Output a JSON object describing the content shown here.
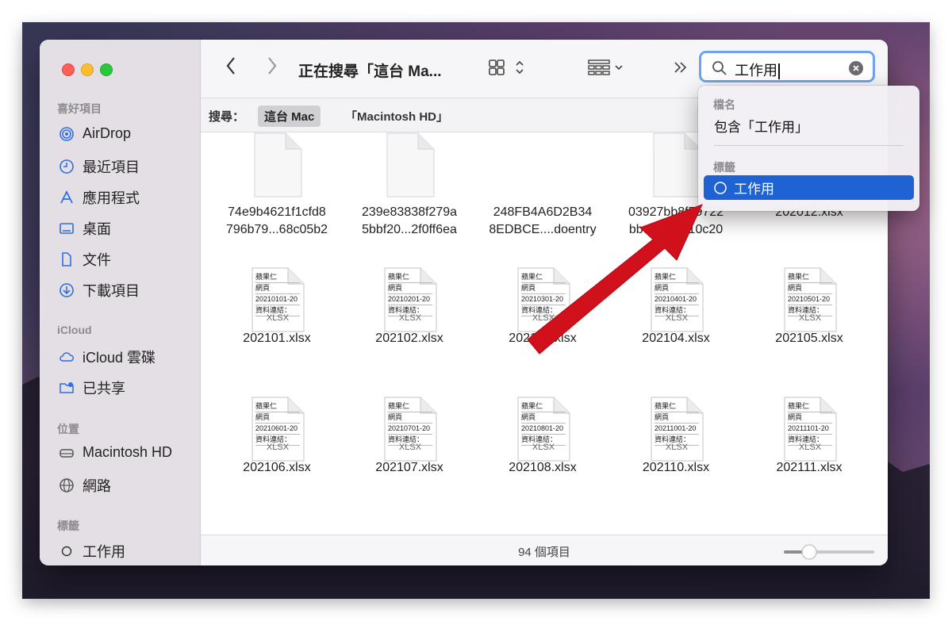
{
  "sidebar": {
    "sections": {
      "favorites": "喜好項目",
      "icloud": "iCloud",
      "locations": "位置",
      "tags": "標籤"
    },
    "favorites": [
      {
        "label": "AirDrop",
        "icon": "airdrop-icon"
      },
      {
        "label": "最近項目",
        "icon": "clock-icon"
      },
      {
        "label": "應用程式",
        "icon": "applications-icon"
      },
      {
        "label": "桌面",
        "icon": "desktop-icon"
      },
      {
        "label": "文件",
        "icon": "document-icon"
      },
      {
        "label": "下載項目",
        "icon": "download-icon"
      }
    ],
    "icloud": [
      {
        "label": "iCloud 雲碟",
        "icon": "cloud-icon"
      },
      {
        "label": "已共享",
        "icon": "shared-folder-icon"
      }
    ],
    "locations": [
      {
        "label": "Macintosh HD",
        "icon": "drive-icon"
      },
      {
        "label": "網路",
        "icon": "globe-icon"
      }
    ],
    "tags": [
      {
        "label": "工作用",
        "icon": "tag-circle-icon"
      }
    ]
  },
  "toolbar": {
    "title": "正在搜尋「這台 Ma...",
    "search_value": "工作用"
  },
  "scopebar": {
    "label": "搜尋：",
    "selected_scope": "這台 Mac",
    "other_scope": "「Macintosh HD」"
  },
  "files": [
    {
      "name": "74e9b4621f1cfd8\n796b79...68c05b2",
      "type": "blank"
    },
    {
      "name": "239e83838f279a\n5bbf20...2f0ff6ea",
      "type": "blank"
    },
    {
      "name": "248FB4A6D2B34\n8EDBCE....doentry",
      "type": "none"
    },
    {
      "name": "03927bb8f59722\nbbe69...cb10c20",
      "type": "blank"
    },
    {
      "name": "202012.xlsx",
      "type": "none"
    },
    {
      "name": "202101.xlsx",
      "type": "xlsx",
      "preview": [
        "蘋果仁",
        "網頁",
        "20210101-20",
        "資料連結："
      ]
    },
    {
      "name": "202102.xlsx",
      "type": "xlsx",
      "preview": [
        "蘋果仁",
        "網頁",
        "20210201-20",
        "資料連結："
      ]
    },
    {
      "name": "202103.xlsx",
      "type": "xlsx",
      "preview": [
        "蘋果仁",
        "網頁",
        "20210301-20",
        "資料連結："
      ]
    },
    {
      "name": "202104.xlsx",
      "type": "xlsx",
      "preview": [
        "蘋果仁",
        "網頁",
        "20210401-20",
        "資料連結："
      ]
    },
    {
      "name": "202105.xlsx",
      "type": "xlsx",
      "preview": [
        "蘋果仁",
        "網頁",
        "20210501-20",
        "資料連結："
      ]
    },
    {
      "name": "202106.xlsx",
      "type": "xlsx",
      "preview": [
        "蘋果仁",
        "網頁",
        "20210601-20",
        "資料連結："
      ]
    },
    {
      "name": "202107.xlsx",
      "type": "xlsx",
      "preview": [
        "蘋果仁",
        "網頁",
        "20210701-20",
        "資料連結："
      ]
    },
    {
      "name": "202108.xlsx",
      "type": "xlsx",
      "preview": [
        "蘋果仁",
        "網頁",
        "20210801-20",
        "資料連結："
      ]
    },
    {
      "name": "202110.xlsx",
      "type": "xlsx",
      "preview": [
        "蘋果仁",
        "網頁",
        "20211001-20",
        "資料連結："
      ]
    },
    {
      "name": "202111.xlsx",
      "type": "xlsx",
      "preview": [
        "蘋果仁",
        "網頁",
        "20211101-20",
        "資料連結："
      ]
    }
  ],
  "file_badge": "XLSX",
  "status": {
    "item_count": "94 個項目"
  },
  "dropdown": {
    "filename_header": "檔名",
    "filename_option": "包含「工作用」",
    "tags_header": "標籤",
    "tag_option": "工作用"
  },
  "colors": {
    "accent": "#1f62d3",
    "arrow": "#d0101a",
    "search_ring": "#6da3f0"
  }
}
